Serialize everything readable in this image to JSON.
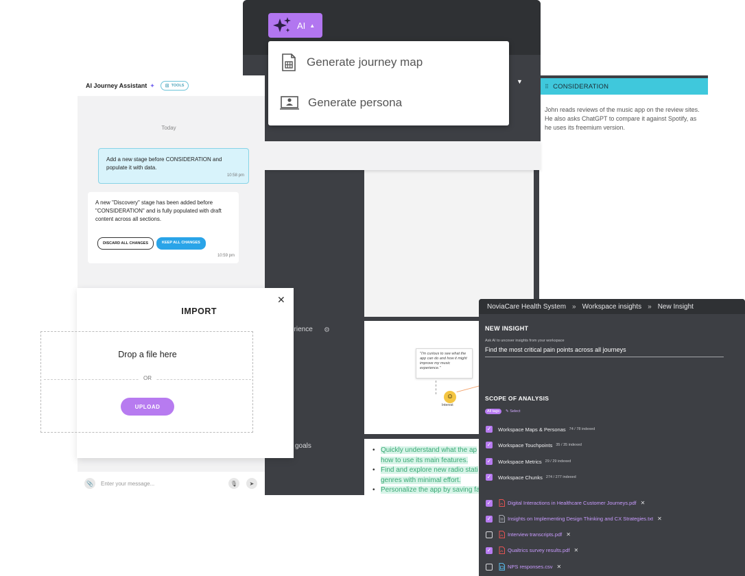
{
  "canvas": {
    "stage_label": "CONSIDERATION",
    "stage_description": "John reads reviews of the music app on the review sites. He also asks ChatGPT to compare it against Spotify, as he uses its freemium version.",
    "experience_label": "erience",
    "goals_label": "goals",
    "persona_quote": "\"I'm curious to see what the app can do and how it might improve my music experience.\"",
    "emotion_label": "Interest",
    "goals": [
      {
        "text_a": "Quickly understand what the ap",
        "text_b": "how to use its main features."
      },
      {
        "text_a": "Find and explore new radio stati",
        "text_b": "genres with minimal effort."
      },
      {
        "text_a": "Personalize the app by saving fa",
        "text_b": ""
      }
    ]
  },
  "ai_menu": {
    "button_label": "AI",
    "items": [
      {
        "label": "Generate journey map",
        "icon": "journey-map-icon"
      },
      {
        "label": "Generate persona",
        "icon": "persona-icon"
      }
    ]
  },
  "chat": {
    "title": "AI Journey Assistant",
    "tools_label": "TOOLS",
    "day_label": "Today",
    "user_message": "Add a new stage before CONSIDERATION and populate it with data.",
    "user_time": "10:58 pm",
    "bot_message": "A new \"Discovery\" stage has been added before \"CONSIDERATION\" and is fully populated with draft content across all sections.",
    "bot_time": "10:59 pm",
    "discard_label": "DISCARD ALL CHANGES",
    "keep_label": "KEEP ALL CHANGES",
    "input_placeholder": "Enter your message..."
  },
  "import": {
    "title": "IMPORT",
    "drop_text": "Drop a file here",
    "or_text": "OR",
    "upload_label": "UPLOAD"
  },
  "insight": {
    "breadcrumbs": [
      "NoviaCare Health System",
      "Workspace insights",
      "New Insight"
    ],
    "title": "NEW INSIGHT",
    "ask_label": "Ask AI to uncover insights from your workspace",
    "ask_value": "Find the most critical pain points across all journeys",
    "scope_title": "SCOPE OF ANALYSIS",
    "all_tags_label": "All tags",
    "select_label": "Select",
    "sources": [
      {
        "label": "Workspace Maps & Personas",
        "count": "74 / 78 indexed",
        "checked": true
      },
      {
        "label": "Workspace Touchpoints",
        "count": "35 / 35 indexed",
        "checked": true
      },
      {
        "label": "Workspace Metrics",
        "count": "29 / 29 indexed",
        "checked": true
      },
      {
        "label": "Workspace Chunks",
        "count": "274 / 277 indexed",
        "checked": true
      }
    ],
    "files": [
      {
        "name": "Digital Interactions in Healthcare Customer Journeys.pdf",
        "type": "pdf",
        "checked": true
      },
      {
        "name": "Insights on Implementing Design Thinking and CX Strategies.txt",
        "type": "txt",
        "checked": true
      },
      {
        "name": "Interview transcripts.pdf",
        "type": "pdf",
        "checked": false
      },
      {
        "name": "Qualtrics survey results.pdf",
        "type": "pdf",
        "checked": true
      },
      {
        "name": "NPS responses.csv",
        "type": "csv",
        "checked": false
      }
    ]
  },
  "colors": {
    "accent_purple": "#b77bf0",
    "consideration_cyan": "#3fc8dc",
    "keep_blue": "#2aa4e8",
    "panel_dark": "#3d3f44"
  }
}
